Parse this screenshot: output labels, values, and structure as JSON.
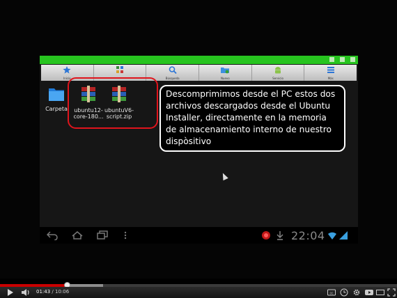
{
  "file_manager": {
    "toolbar": [
      {
        "label": "Inicio",
        "icon": "star-icon"
      },
      {
        "label": "",
        "icon": "apps-icon"
      },
      {
        "label": "Búsqueda",
        "icon": "search-icon"
      },
      {
        "label": "Nuevo",
        "icon": "folder-icon"
      },
      {
        "label": "Servicio",
        "icon": "android-icon"
      },
      {
        "label": "Más",
        "icon": "list-icon"
      }
    ],
    "files": [
      {
        "name": "Carpeta",
        "icon": "folder-icon"
      },
      {
        "name": "ubuntu12-core-180...",
        "icon": "winrar-archive-icon"
      },
      {
        "name": "ubuntuV6-script.zip",
        "icon": "winrar-archive-icon"
      }
    ]
  },
  "annotation": {
    "text": "Descomprimimos desde el PC estos dos archivos descargados desde el Ubuntu Installer, directamente en la memoria de almacenamiento interno de nuestro dispòsitivo"
  },
  "system_bar": {
    "clock": "22:04",
    "icons": [
      "back-icon",
      "home-icon",
      "recent-apps-icon",
      "menu-icon",
      "record-icon",
      "download-icon",
      "wifi-icon",
      "signal-icon"
    ]
  },
  "player": {
    "current_time": "01:43",
    "separator": " / ",
    "duration": "10:06",
    "progress_fraction": 0.17,
    "buffered_fraction": 0.26,
    "colors": {
      "played": "#c90000",
      "accent_green": "#27c41f",
      "highlight_red": "#e0141c"
    }
  }
}
